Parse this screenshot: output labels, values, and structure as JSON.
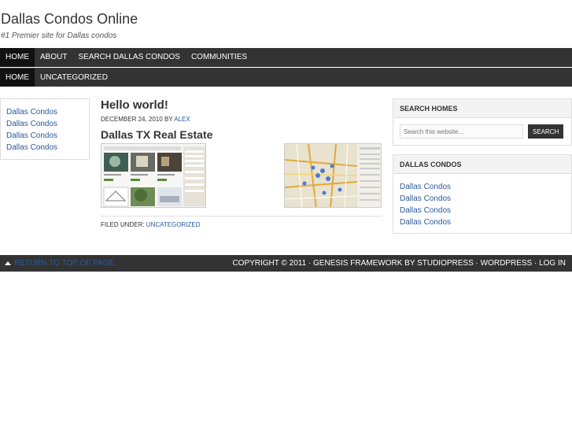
{
  "site": {
    "title": "Dallas Condos Online",
    "description": "#1 Premier site for Dallas condos"
  },
  "nav_primary": [
    {
      "label": "Home"
    },
    {
      "label": "About"
    },
    {
      "label": "Search Dallas Condos"
    },
    {
      "label": "Communities"
    }
  ],
  "nav_secondary": [
    {
      "label": "Home"
    },
    {
      "label": "Uncategorized"
    }
  ],
  "left_sidebar": {
    "links": [
      "Dallas Condos",
      "Dallas Condos",
      "Dallas Condos",
      "Dallas Condos"
    ]
  },
  "post": {
    "title": "Hello world!",
    "date": "December 24, 2010",
    "by": "by",
    "author": "Alex",
    "heading": "Dallas TX Real Estate",
    "filed_label": "Filed Under:",
    "category": "Uncategorized"
  },
  "search_widget": {
    "title": "Search Homes",
    "placeholder": "Search this website...",
    "button": "Search"
  },
  "condos_widget": {
    "title": "Dallas Condos",
    "links": [
      "Dallas Condos",
      "Dallas Condos",
      "Dallas Condos",
      "Dallas Condos"
    ]
  },
  "footer": {
    "back_to_top": "Return to top of page",
    "right_text": "Copyright © 2011 · Genesis Framework by StudioPress · WordPress · Log in"
  }
}
